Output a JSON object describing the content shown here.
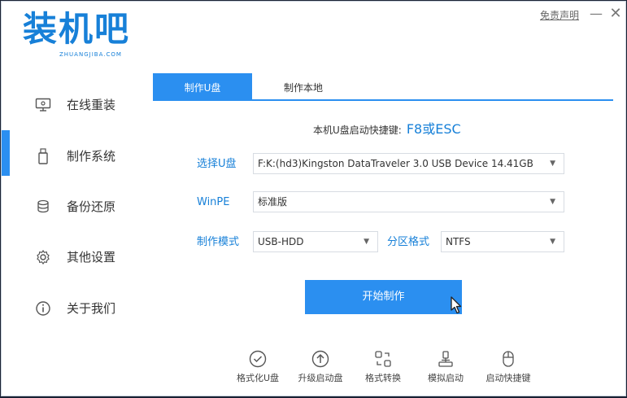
{
  "app": {
    "logo_text": "装机吧",
    "logo_subtext": "ZHUANGJIBA.COM",
    "disclaimer": "免责声明",
    "minimize_glyph": "—",
    "close_glyph": "✕"
  },
  "sidebar": {
    "items": [
      {
        "label": "在线重装",
        "icon": "monitor-icon"
      },
      {
        "label": "制作系统",
        "icon": "usb-icon",
        "active": true
      },
      {
        "label": "备份还原",
        "icon": "backup-icon"
      },
      {
        "label": "其他设置",
        "icon": "gear-icon"
      },
      {
        "label": "关于我们",
        "icon": "info-icon"
      }
    ]
  },
  "tabs": [
    {
      "label": "制作U盘",
      "active": true
    },
    {
      "label": "制作本地",
      "active": false
    }
  ],
  "shortcut": {
    "label": "本机U盘启动快捷键:",
    "key": "F8或ESC"
  },
  "form": {
    "usb_label": "选择U盘",
    "usb_value": "F:K:(hd3)Kingston DataTraveler 3.0 USB Device 14.41GB",
    "winpe_label": "WinPE",
    "winpe_value": "标准版",
    "mode_label": "制作模式",
    "mode_value": "USB-HDD",
    "partition_label": "分区格式",
    "partition_value": "NTFS"
  },
  "start_button": "开始制作",
  "tools": [
    {
      "label": "格式化U盘",
      "icon": "check-circle-icon"
    },
    {
      "label": "升级启动盘",
      "icon": "upgrade-icon"
    },
    {
      "label": "格式转换",
      "icon": "convert-icon"
    },
    {
      "label": "模拟启动",
      "icon": "simulate-icon"
    },
    {
      "label": "启动快捷键",
      "icon": "mouse-icon"
    }
  ],
  "colors": {
    "accent": "#2b8ff0",
    "brand": "#1780d8"
  }
}
